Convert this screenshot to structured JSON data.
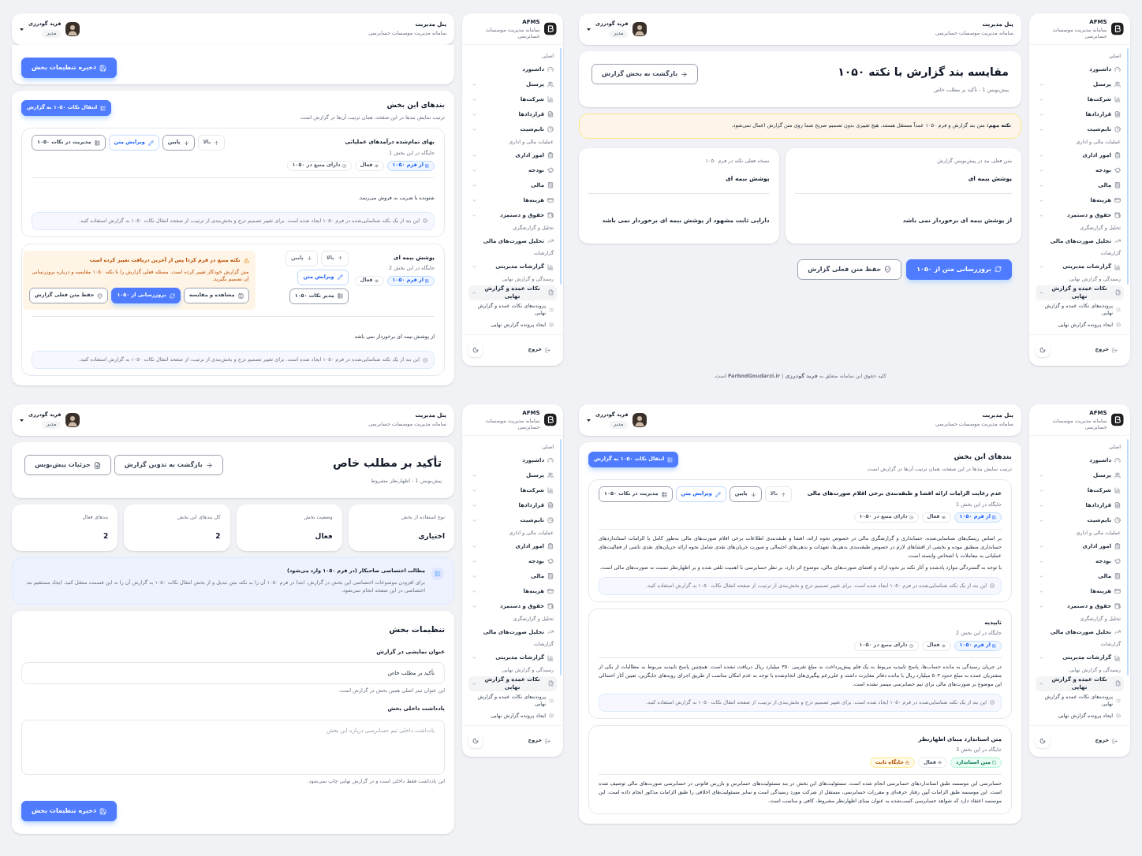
{
  "screens": [
    {
      "kind": "compare",
      "header": {
        "title": "پنل مدیریت",
        "subtitle": "سامانه مدیریت موسسات حسابرسی",
        "user_name": "فرید گودرزی",
        "user_role": "مدیر"
      },
      "title": "مقایسه بند گزارش با نکته ۱۰۵۰",
      "subtitle": "پیش‌نویس 1 - تأکید بر مطلب خاص",
      "buttons": [
        {
          "kind": "back",
          "label": "بازگشت به بخش گزارش"
        }
      ],
      "notice": "**نکته مهم:** متن بند گزارش و فرم ۱۰۵۰ عمداً مستقل هستند. هیچ تغییری بدون تصمیم صریح شما روی متن گزارش اعمال نمی‌شود.",
      "columns": [
        {
          "label": "متن فعلی بند در پیش‌نویس گزارش",
          "title": "پوشش بیمه ای",
          "text": "از پوشش بیمه ای برخوردار نمی باشد"
        },
        {
          "label": "نسخه فعلی نکته در فرم ۱۰۵۰",
          "title": "پوشش بیمه ای",
          "text": "دارایی ثابت مشهود از پوشش بیمه ای برخوردار نمی باشد"
        }
      ],
      "actions": [
        {
          "kind": "update",
          "label": "بروزرسانی متن از ۱۰۵۰"
        },
        {
          "kind": "keep",
          "label": "حفظ متن فعلی گزارش"
        }
      ],
      "footer": "کلیه حقوق این سامانه متعلق به **فرید گودرزی** | **FarbodGoudarzi.ir** است.",
      "sidebar": {
        "brand": "AFMS",
        "brand_subtitle": "سامانه مدیریت موسسات حسابرسی",
        "groups": [
          {
            "label": "اصلی",
            "items": [
              {
                "kind": "link",
                "label": "داشبورد",
                "selected": false
              },
              {
                "kind": "menu",
                "label": "پرسنل",
                "selected": false,
                "expanded": false
              },
              {
                "kind": "menu",
                "label": "شرکت‌ها",
                "selected": false,
                "expanded": false
              },
              {
                "kind": "menu",
                "label": "قراردادها",
                "selected": false,
                "expanded": false
              },
              {
                "kind": "menu",
                "label": "تایم‌شیت",
                "selected": false,
                "expanded": false
              }
            ]
          },
          {
            "label": "عملیات مالی و اداری",
            "items": [
              {
                "kind": "menu",
                "label": "امور اداری",
                "selected": false,
                "expanded": false
              },
              {
                "kind": "menu",
                "label": "بودجه",
                "selected": false,
                "expanded": false
              },
              {
                "kind": "menu",
                "label": "مالی",
                "selected": false,
                "expanded": false
              },
              {
                "kind": "menu",
                "label": "هزینه‌ها",
                "selected": false,
                "expanded": false
              },
              {
                "kind": "menu",
                "label": "حقوق و دستمزد",
                "selected": false,
                "expanded": false
              }
            ]
          },
          {
            "label": "تحلیل و گزارشگری",
            "items": [
              {
                "kind": "link",
                "label": "تحلیل صورت‌های مالی",
                "selected": false
              }
            ]
          },
          {
            "label": "گزارشات",
            "items": [
              {
                "kind": "menu",
                "label": "گزارشات مدیریتی",
                "selected": false,
                "expanded": false
              }
            ]
          },
          {
            "label": "رسیدگی و گزارش نهایی",
            "items": [
              {
                "kind": "menu",
                "label": "نکات عمده و گزارش نهایی",
                "selected": true,
                "expanded": true,
                "children": [
                  {
                    "label": "پرونده‌های نکات عمده و گزارش نهایی",
                    "selected": false
                  },
                  {
                    "label": "ایجاد پرونده گزارش نهایی",
                    "selected": false
                  }
                ]
              }
            ]
          }
        ],
        "logout": "خروج"
      }
    },
    {
      "kind": "clauses",
      "header": {
        "title": "پنل مدیریت",
        "subtitle": "سامانه مدیریت موسسات حسابرسی",
        "user_name": "فرید گودرزی",
        "user_role": "مدیر"
      },
      "top_card": {
        "buttons": [
          {
            "kind": "save",
            "label": "ذخیره تنظیمات بخش"
          }
        ]
      },
      "clauses_card": {
        "title": "بندهای این بخش",
        "description": "ترتیب نمایش بندها در این صفحه، همان ترتیب آن‌ها در گزارش است.",
        "button": {
          "kind": "transfer",
          "label": "انتقال نکات ۱۰۵۰ به گزارش"
        },
        "clauses": [
          {
            "title": "بهای تمام‌شده درآمدهای عملیاتی",
            "position": "جایگاه در این بخش 1",
            "tags": [
              {
                "kind": "source",
                "label": "از فرم ۱۰۵۰"
              },
              {
                "kind": "status",
                "label": "فعال"
              },
              {
                "kind": "linked",
                "label": "دارای منبع در ۱۰۵۰"
              }
            ],
            "buttons": [
              {
                "kind": "up",
                "label": "بالا",
                "disabled": true
              },
              {
                "kind": "down",
                "label": "پایین",
                "disabled": false
              },
              {
                "kind": "edit",
                "label": "ویرایش متن",
                "disabled": false
              },
              {
                "kind": "manage",
                "label": "مدیریت در نکات ۱۰۵۰",
                "disabled": false
              }
            ],
            "paragraphs": [
              "شنونده با ضریب به فروش می‌رسد."
            ],
            "note": "این بند از یک نکته شناسایی‌شده در فرم ۱۰۵۰ ایجاد شده است. برای تغییر تصمیم درج و بخش‌بندی از ترتیب، از صفحه انتقال نکات ۱۰۵۰ به گزارش استفاده کنید."
          },
          {
            "title": "پوشش بیمه ای",
            "position": "جایگاه در این بخش 2",
            "tags": [
              {
                "kind": "source",
                "label": "از فرم ۱۰۵۰"
              },
              {
                "kind": "status",
                "label": "فعال"
              }
            ],
            "buttons": [
              {
                "kind": "up",
                "label": "بالا",
                "disabled": true
              },
              {
                "kind": "down",
                "label": "پایین",
                "disabled": true
              },
              {
                "kind": "edit",
                "label": "ویرایش متن",
                "disabled": false
              },
              {
                "kind": "manage",
                "label": "مدیر نکات ۱۰۵۰",
                "disabled": false
              }
            ],
            "alert": {
              "title": "نکته منبع در فرم کردا پس از آخرین دریافت تغییر کرده است",
              "text": "متن گزارش خودکار تغییر کرده است. مسئله فعلی گزارش را با نکته ۱۰۵۰ مقایسه و درباره بروزرسانی آن تصمیم بگیرید.",
              "buttons": [
                {
                  "kind": "compare",
                  "label": "مشاهده و مقایسه"
                },
                {
                  "kind": "update",
                  "label": "بروزرسانی از ۱۰۵۰"
                },
                {
                  "kind": "keep",
                  "label": "حفظ متن فعلی گزارش"
                }
              ]
            },
            "paragraphs": [
              "از پوشش بیمه ای برخوردار نمی باشد"
            ],
            "note": "این بند از یک نکته شناسایی‌شده در فرم ۱۰۵۰ ایجاد شده است. برای تغییر تصمیم درج و بخش‌بندی از ترتیب، از صفحه انتقال نکات ۱۰۵۰ به گزارش استفاده کنید."
          }
        ]
      },
      "sidebar": {
        "brand": "AFMS",
        "brand_subtitle": "سامانه مدیریت موسسات حسابرسی",
        "groups": [
          {
            "label": "اصلی",
            "items": [
              {
                "kind": "link",
                "label": "داشبورد",
                "selected": false
              },
              {
                "kind": "menu",
                "label": "پرسنل",
                "selected": false,
                "expanded": false
              },
              {
                "kind": "menu",
                "label": "شرکت‌ها",
                "selected": false,
                "expanded": false
              },
              {
                "kind": "menu",
                "label": "قراردادها",
                "selected": false,
                "expanded": false
              },
              {
                "kind": "menu",
                "label": "تایم‌شیت",
                "selected": false,
                "expanded": false
              }
            ]
          },
          {
            "label": "عملیات مالی و اداری",
            "items": [
              {
                "kind": "menu",
                "label": "امور اداری",
                "selected": false,
                "expanded": false
              },
              {
                "kind": "menu",
                "label": "بودجه",
                "selected": false,
                "expanded": false
              },
              {
                "kind": "menu",
                "label": "مالی",
                "selected": false,
                "expanded": false
              },
              {
                "kind": "menu",
                "label": "هزینه‌ها",
                "selected": false,
                "expanded": false
              },
              {
                "kind": "menu",
                "label": "حقوق و دستمزد",
                "selected": false,
                "expanded": false
              }
            ]
          },
          {
            "label": "تحلیل و گزارشگری",
            "items": [
              {
                "kind": "link",
                "label": "تحلیل صورت‌های مالی",
                "selected": false
              }
            ]
          },
          {
            "label": "گزارشات",
            "items": [
              {
                "kind": "menu",
                "label": "گزارشات مدیریتی",
                "selected": false,
                "expanded": false
              }
            ]
          },
          {
            "label": "رسیدگی و گزارش نهایی",
            "items": [
              {
                "kind": "menu",
                "label": "نکات عمده و گزارش نهایی",
                "selected": true,
                "expanded": true,
                "children": [
                  {
                    "label": "پرونده‌های نکات عمده و گزارش نهایی",
                    "selected": false
                  },
                  {
                    "label": "ایجاد پرونده گزارش نهایی",
                    "selected": false
                  }
                ]
              }
            ]
          }
        ],
        "logout": "خروج"
      }
    },
    {
      "kind": "clauses",
      "header": {
        "title": "پنل مدیریت",
        "subtitle": "سامانه مدیریت موسسات حسابرسی",
        "user_name": "فرید گودرزی",
        "user_role": "مدیر"
      },
      "clauses_card": {
        "title": "بندهای این بخش",
        "description": "ترتیب نمایش بندها در این صفحه، همان ترتیب آن‌ها در گزارش است.",
        "button": {
          "kind": "transfer",
          "label": "انتقال نکات ۱۰۵۰ به گزارش"
        },
        "clauses": [
          {
            "title": "عدم رعایت الزامات ارائه افشا و طبقه‌بندی برخی اقلام صورت‌های مالی",
            "position": "جایگاه در این بخش 1",
            "tags": [
              {
                "kind": "source",
                "label": "از فرم ۱۰۵۰"
              },
              {
                "kind": "status",
                "label": "فعال"
              },
              {
                "kind": "linked",
                "label": "دارای منبع در ۱۰۵۰"
              }
            ],
            "buttons": [
              {
                "kind": "up",
                "label": "بالا",
                "disabled": true
              },
              {
                "kind": "down",
                "label": "پایین",
                "disabled": false
              },
              {
                "kind": "edit",
                "label": "ویرایش متن",
                "disabled": false
              },
              {
                "kind": "manage",
                "label": "مدیریت در نکات ۱۰۵۰",
                "disabled": false
              }
            ],
            "paragraphs": [
              "بر اساس ریسک‌های شناسایی‌شده، حسابداری و گزارشگری مالی در خصوص نحوه ارائه، افشا و طبقه‌بندی اطلاعات برخی اقلام صورت‌های مالی به‌طور کامل با الزامات استانداردهای حسابداری منطبق نبوده و بخشی از افشاهای لازم در خصوص طبقه‌بندی بدهی‌ها، تعهدات و بدهی‌های احتمالی و صورت جریان‌های نقدی شامل نحوه ارائه جریان‌های نقدی ناشی از فعالیت‌های عملیاتی به معاملات با اشخاص وابسته است.",
              "با توجه به گستردگی موارد یادشده و آثار نکته بر نحوه ارائه و افشای صورت‌های مالی، موضوع اثر دارد، بر نظر حسابرسی با اهمیت تلقی شده و بر اظهارنظر نسبت به صورت‌های مالی است."
            ],
            "note": "این بند از یک نکته شناسایی‌شده در فرم ۱۰۵۰ ایجاد شده است. برای تغییر تصمیم درج و بخش‌بندی از ترتیب، از صفحه انتقال نکات ۱۰۵۰ به گزارش استفاده کنید."
          },
          {
            "title": "تاییدیه",
            "position": "جایگاه در این بخش 2",
            "tags": [
              {
                "kind": "source",
                "label": "از فرم ۱۰۵۰"
              },
              {
                "kind": "status",
                "label": "فعال"
              },
              {
                "kind": "linked",
                "label": "دارای منبع در ۱۰۵۰"
              }
            ],
            "paragraphs": [
              "در جریان رسیدگی به مانده حساب‌ها، پاسخ تاییدیه مربوط به یک قلم پیش‌پرداخت به مبلغ تقریبی ۳۵۰ میلیارد ریال دریافت نشده است. همچنین پاسخ تاییدیه مربوط به مطالبات از یکی از مشتریان عمده به مبلغ حدود ۵۰۳ میلیارد ریال با مانده دفاتر مغایرت داشته و علی‌رغم پیگیری‌های انجام‌شده با توجه به عدم امکان مناسب از طریق اجرای رویه‌های جایگزین، تعیین آثار احتمالی این موضوع بر صورت‌های مالی برای تیم حسابرسی میسر نشده است."
            ],
            "note": "این بند از یک نکته شناسایی‌شده در فرم ۱۰۵۰ ایجاد شده است. برای تغییر تصمیم درج و بخش‌بندی از ترتیب، از صفحه انتقال نکات ۱۰۵۰ به گزارش استفاده کنید."
          },
          {
            "title": "متن استاندارد مبنای اظهارنظر",
            "position": "جایگاه در این بخش 3",
            "tags": [
              {
                "kind": "standard",
                "label": "متن استاندارد"
              },
              {
                "kind": "status",
                "label": "فعال"
              },
              {
                "kind": "fixed",
                "label": "جایگاه ثابت"
              }
            ],
            "paragraphs": [
              "حسابرسی این موسسه طبق استانداردهای حسابرسی انجام شده است. مسئولیت‌های این بخش در بند مسئولیت‌های حسابرس و بازرس قانونی در حسابرسی صورت‌های مالی توصیف شده است. این موسسه طبق الزامات آیین رفتار حرفه‌ای و مقررات حسابرسی، مستقل از شرکت مورد رسیدگی است و سایر مسئولیت‌های اخلاقی را طبق الزامات مذکور انجام داده است. این موسسه اعتقاد دارد که شواهد حسابرسی کسب‌شده به عنوان مبنای اظهارنظر مشروط، کافی و مناسب است."
            ]
          }
        ]
      },
      "sidebar": {
        "brand": "AFMS",
        "brand_subtitle": "سامانه مدیریت موسسات حسابرسی",
        "groups": [
          {
            "label": "اصلی",
            "items": [
              {
                "kind": "link",
                "label": "داشبورد",
                "selected": false
              },
              {
                "kind": "menu",
                "label": "پرسنل",
                "selected": false,
                "expanded": false
              },
              {
                "kind": "menu",
                "label": "شرکت‌ها",
                "selected": false,
                "expanded": false
              },
              {
                "kind": "menu",
                "label": "قراردادها",
                "selected": false,
                "expanded": false
              },
              {
                "kind": "menu",
                "label": "تایم‌شیت",
                "selected": false,
                "expanded": false
              }
            ]
          },
          {
            "label": "عملیات مالی و اداری",
            "items": [
              {
                "kind": "menu",
                "label": "امور اداری",
                "selected": false,
                "expanded": false
              },
              {
                "kind": "menu",
                "label": "بودجه",
                "selected": false,
                "expanded": false
              },
              {
                "kind": "menu",
                "label": "مالی",
                "selected": false,
                "expanded": false
              },
              {
                "kind": "menu",
                "label": "هزینه‌ها",
                "selected": false,
                "expanded": false
              },
              {
                "kind": "menu",
                "label": "حقوق و دستمزد",
                "selected": false,
                "expanded": false
              }
            ]
          },
          {
            "label": "تحلیل و گزارشگری",
            "items": [
              {
                "kind": "link",
                "label": "تحلیل صورت‌های مالی",
                "selected": false
              }
            ]
          },
          {
            "label": "گزارشات",
            "items": [
              {
                "kind": "menu",
                "label": "گزارشات مدیریتی",
                "selected": false,
                "expanded": false
              }
            ]
          },
          {
            "label": "رسیدگی و گزارش نهایی",
            "items": [
              {
                "kind": "menu",
                "label": "نکات عمده و گزارش نهایی",
                "selected": true,
                "expanded": true,
                "children": [
                  {
                    "label": "پرونده‌های نکات عمده و گزارش نهایی",
                    "selected": false
                  },
                  {
                    "label": "ایجاد پرونده گزارش نهایی",
                    "selected": false
                  }
                ]
              }
            ]
          }
        ],
        "logout": "خروج"
      }
    },
    {
      "kind": "section",
      "header": {
        "title": "پنل مدیریت",
        "subtitle": "سامانه مدیریت موسسات حسابرسی",
        "user_name": "فرید گودرزی",
        "user_role": "مدیر"
      },
      "title": "تأکید بر مطلب خاص",
      "subtitle": "پیش‌نویس 1 - اظهارنظر مشروط",
      "buttons": [
        {
          "kind": "back",
          "label": "بازگشت به تدوین گزارش"
        },
        {
          "kind": "details",
          "label": "جزئیات پیش‌نویس"
        }
      ],
      "stats": [
        {
          "label": "نوع استفاده از بخش",
          "value": "اختیاری"
        },
        {
          "label": "وضعیت بخش",
          "value": "فعال"
        },
        {
          "label": "کل بندهای این بخش",
          "value": "2"
        },
        {
          "label": "بندهای فعال",
          "value": "2"
        }
      ],
      "info": {
        "title": "مطالب اختصاصی صاحبکار (در فرم ۱۰۵۰ وارد می‌شود)",
        "text": "برای افزودن موضوعات اختصاصی این بخش در گزارش، ابتدا در فرم ۱۰۵۰ آن را به نکته متن تبدیل و از بخش انتقال نکات ۱۰۵۰ به گزارش آن را به این قسمت منتقل کنید. ایجاد مستقیم بند اختصاصی در این صفحه انجام نمی‌شود."
      },
      "settings": {
        "title": "تنظیمات بخش",
        "fields": [
          {
            "kind": "input",
            "label": "عنوان نمایشی در گزارش",
            "value": "تأکید بر مطلب خاص",
            "hint": "این عنوان تیتر اصلی همین بخش در گزارش است."
          },
          {
            "kind": "textarea",
            "label": "یادداشت داخلی بخش",
            "placeholder": "یادداشت داخلی تیم حسابرسی درباره این بخش",
            "hint": "این یادداشت فقط داخلی است و در گزارش نهایی چاپ نمی‌شود."
          }
        ],
        "button": {
          "kind": "save",
          "label": "ذخیره تنظیمات بخش"
        }
      },
      "sidebar": {
        "brand": "AFMS",
        "brand_subtitle": "سامانه مدیریت موسسات حسابرسی",
        "groups": [
          {
            "label": "اصلی",
            "items": [
              {
                "kind": "link",
                "label": "داشبورد",
                "selected": false
              },
              {
                "kind": "menu",
                "label": "پرسنل",
                "selected": false,
                "expanded": false
              },
              {
                "kind": "menu",
                "label": "شرکت‌ها",
                "selected": false,
                "expanded": false
              },
              {
                "kind": "menu",
                "label": "قراردادها",
                "selected": false,
                "expanded": false
              },
              {
                "kind": "menu",
                "label": "تایم‌شیت",
                "selected": false,
                "expanded": false
              }
            ]
          },
          {
            "label": "عملیات مالی و اداری",
            "items": [
              {
                "kind": "menu",
                "label": "امور اداری",
                "selected": false,
                "expanded": false
              },
              {
                "kind": "menu",
                "label": "بودجه",
                "selected": false,
                "expanded": false
              },
              {
                "kind": "menu",
                "label": "مالی",
                "selected": false,
                "expanded": false
              },
              {
                "kind": "menu",
                "label": "هزینه‌ها",
                "selected": false,
                "expanded": false
              },
              {
                "kind": "menu",
                "label": "حقوق و دستمزد",
                "selected": false,
                "expanded": false
              }
            ]
          },
          {
            "label": "تحلیل و گزارشگری",
            "items": [
              {
                "kind": "link",
                "label": "تحلیل صورت‌های مالی",
                "selected": false
              }
            ]
          },
          {
            "label": "گزارشات",
            "items": [
              {
                "kind": "menu",
                "label": "گزارشات مدیریتی",
                "selected": false,
                "expanded": false
              }
            ]
          },
          {
            "label": "رسیدگی و گزارش نهایی",
            "items": [
              {
                "kind": "menu",
                "label": "نکات عمده و گزارش نهایی",
                "selected": true,
                "expanded": true,
                "children": [
                  {
                    "label": "پرونده‌های نکات عمده و گزارش نهایی",
                    "selected": false
                  },
                  {
                    "label": "ایجاد پرونده گزارش نهایی",
                    "selected": false
                  }
                ]
              }
            ]
          }
        ],
        "logout": "خروج"
      }
    }
  ]
}
